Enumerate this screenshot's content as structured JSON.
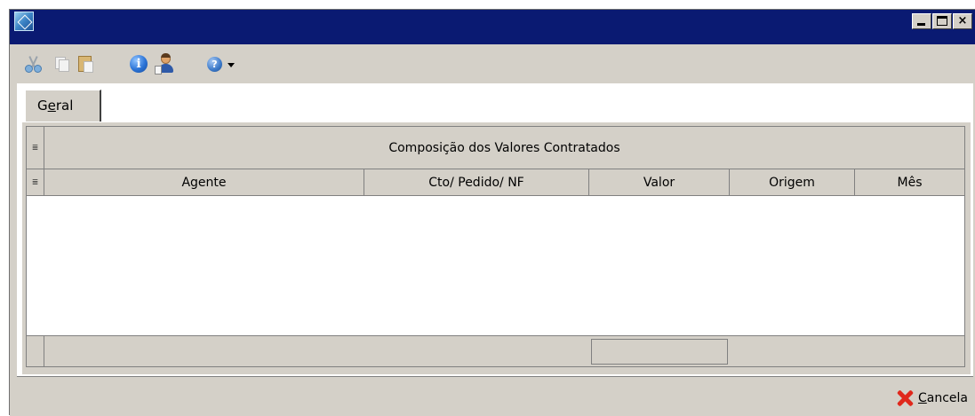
{
  "window": {
    "title": "",
    "buttons": {
      "minimize": "_",
      "maximize": "□",
      "close": "×"
    }
  },
  "toolbar": {
    "items": [
      "scissors-icon",
      "copy-icon",
      "paste-icon",
      "info-icon",
      "user-icon",
      "help-icon",
      "dropdown-arrow-icon"
    ]
  },
  "tabs": [
    {
      "label": "Geral"
    }
  ],
  "grid": {
    "title": "Composição dos Valores Contratados",
    "columns": [
      "Agente",
      "Cto/ Pedido/ NF",
      "Valor",
      "Origem",
      "Mês"
    ],
    "rows": []
  },
  "footer": {
    "cancel_label": "Cancela"
  },
  "colors": {
    "titlebar": "#0a1a72",
    "window_bg": "#d4d0c8",
    "cancel_icon": "#e0281c"
  }
}
